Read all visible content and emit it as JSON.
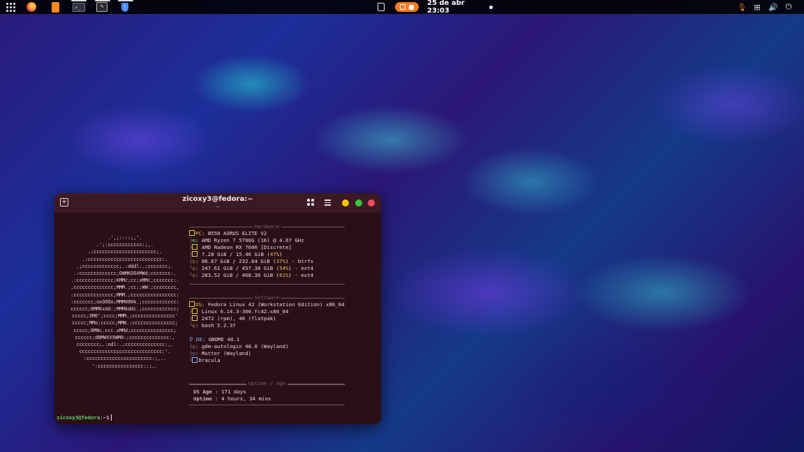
{
  "topbar": {
    "clock": "25 de abr  23:03",
    "icons": [
      "apps-grid-icon",
      "firefox-icon",
      "files-icon",
      "terminal-icon",
      "system-monitor-icon",
      "security-shield-icon",
      "clipboard-icon",
      "screen-record-indicator-icon",
      "notification-dot-icon",
      "microphone-icon",
      "network-icon",
      "volume-icon",
      "power-icon"
    ],
    "accent": "#f57c1f"
  },
  "terminal": {
    "title": "zicoxy3@fedora:~",
    "subtitle": "~",
    "prompt_user": "zicoxy3@fedora",
    "prompt_rest": ":~$",
    "logo_lines": [
      ".',;::::;,'.",
      ".';:cccccccccccc:;,.",
      ".;cccccccccccccccccccccc;.",
      ".:cccccccccccccccccccccccccc:.",
      ".;ccccccccccccc;.:dddl:.;ccccccc;.",
      ".:ccccccccccccc;OWMKOOXMWd;ccccccc:.",
      ".:ccccccccccccc;KMMc;cc;xMMc;ccccccc:.",
      ",cccccccccccccc;MMM.;cc;;WW:;cccccccc,",
      ":cccccccccccccc;MMM.;cccccccccccccccc:",
      ":ccccccc;oxOOOo;MMM000k.;cccccccccccc:",
      "cccccc;0MMKxdd:;MMMkddc.;cccccccccccc;",
      "ccccc;XMO';cccc;MMM.;ccccccccccccccc'",
      "ccccc;MMo;ccccc;MMW.;ccccccccccccccc;",
      "ccccc;0MNc.ccc.xMMd;ccccccccccccccc;",
      "cccccc;dNMWXXXWM0:;cccccccccccccc:,",
      "cccccccc;.:odl:.;cccccccccccccc:,.",
      "ccccccccccccccccccccccccccccc:'.",
      ":ccccccccccccccccccccccc:;,..",
      "':cccccccccccccccc::;,."
    ],
    "hardware": {
      "title": "Hardware",
      "pc_label": "PC",
      "pc": "B550 AORUS ELITE V2",
      "cpu": "AMD Ryzen 7 5700G (16) @ 4.67 GHz",
      "gpu": "AMD Radeon RX 7600 [Discrete]",
      "mem": "7.28 GiB / 15.46 GiB",
      "mem_pct": "47%",
      "disk1": "86.67 GiB / 232.84 GiB",
      "disk1_pct": "37%",
      "disk1_fs": "btrfs",
      "disk2": "247.61 GiB / 457.38 GiB",
      "disk2_pct": "54%",
      "disk2_fs": "ext4",
      "disk3": "283.52 GiB / 468.38 GiB",
      "disk3_pct": "61%",
      "disk3_fs": "ext4"
    },
    "software": {
      "title": "Software",
      "os_label": "OS",
      "os": "Fedora Linux 42 (Workstation Edition) x86_64",
      "kernel": "Linux 6.14.3-300.fc42.x86_64",
      "packages": "2472 (rpm), 46 (flatpak)",
      "shell": "bash 5.2.37",
      "de_label": "DE",
      "de": "GNOME 48.1",
      "lm": "gdm-autologin 48.0 (Wayland)",
      "wm": "Mutter (Wayland)",
      "theme": "Dracula"
    },
    "uptime": {
      "title": "Uptime / Age",
      "os_age_label": "OS Age ",
      "os_age": "171 days",
      "uptime_label": "Uptime ",
      "uptime": "4 hours, 34 mins"
    }
  }
}
